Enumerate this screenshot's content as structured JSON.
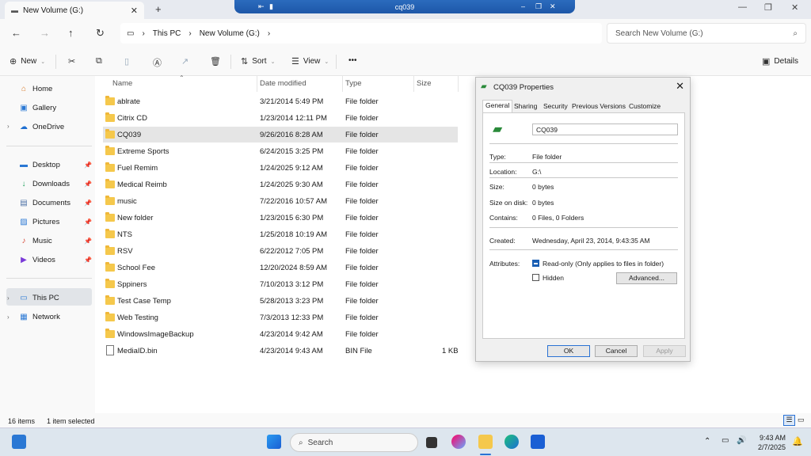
{
  "window": {
    "tab_title": "New Volume (G:)",
    "tab_close": "✕",
    "new_tab": "+",
    "minimize": "—",
    "maximize": "❐",
    "close": "✕"
  },
  "citrix_bar": {
    "title": "cq039"
  },
  "address": {
    "crumbs": [
      "This PC",
      "New Volume (G:)"
    ],
    "search_placeholder": "Search New Volume (G:)"
  },
  "toolbar": {
    "new": "New",
    "sort": "Sort",
    "view": "View",
    "more": "•••",
    "details": "Details"
  },
  "sidebar": {
    "items": [
      {
        "label": "Home",
        "icon": "home-icon"
      },
      {
        "label": "Gallery",
        "icon": "gallery-icon"
      },
      {
        "label": "OneDrive",
        "icon": "cloud-icon"
      },
      {
        "label": "Desktop",
        "icon": "desktop-icon"
      },
      {
        "label": "Downloads",
        "icon": "download-icon"
      },
      {
        "label": "Documents",
        "icon": "documents-icon"
      },
      {
        "label": "Pictures",
        "icon": "pictures-icon"
      },
      {
        "label": "Music",
        "icon": "music-icon"
      },
      {
        "label": "Videos",
        "icon": "videos-icon"
      },
      {
        "label": "This PC",
        "icon": "computer-icon"
      },
      {
        "label": "Network",
        "icon": "network-icon"
      }
    ]
  },
  "columns": {
    "name": "Name",
    "date": "Date modified",
    "type": "Type",
    "size": "Size"
  },
  "files": [
    {
      "name": "ablrate",
      "date": "3/21/2014 5:49 PM",
      "type": "File folder",
      "size": ""
    },
    {
      "name": "Citrix CD",
      "date": "1/23/2014 12:11 PM",
      "type": "File folder",
      "size": ""
    },
    {
      "name": "CQ039",
      "date": "9/26/2016 8:28 AM",
      "type": "File folder",
      "size": ""
    },
    {
      "name": "Extreme Sports",
      "date": "6/24/2015 3:25 PM",
      "type": "File folder",
      "size": ""
    },
    {
      "name": "Fuel Remim",
      "date": "1/24/2025 9:12 AM",
      "type": "File folder",
      "size": ""
    },
    {
      "name": "Medical Reimb",
      "date": "1/24/2025 9:30 AM",
      "type": "File folder",
      "size": ""
    },
    {
      "name": "music",
      "date": "7/22/2016 10:57 AM",
      "type": "File folder",
      "size": ""
    },
    {
      "name": "New folder",
      "date": "1/23/2015 6:30 PM",
      "type": "File folder",
      "size": ""
    },
    {
      "name": "NTS",
      "date": "1/25/2018 10:19 AM",
      "type": "File folder",
      "size": ""
    },
    {
      "name": "RSV",
      "date": "6/22/2012 7:05 PM",
      "type": "File folder",
      "size": ""
    },
    {
      "name": "School Fee",
      "date": "12/20/2024 8:59 AM",
      "type": "File folder",
      "size": ""
    },
    {
      "name": "Sppiners",
      "date": "7/10/2013 3:12 PM",
      "type": "File folder",
      "size": ""
    },
    {
      "name": "Test Case Temp",
      "date": "5/28/2013 3:23 PM",
      "type": "File folder",
      "size": ""
    },
    {
      "name": "Web Testing",
      "date": "7/3/2013 12:33 PM",
      "type": "File folder",
      "size": ""
    },
    {
      "name": "WindowsImageBackup",
      "date": "4/23/2014 9:42 AM",
      "type": "File folder",
      "size": ""
    },
    {
      "name": "MediaID.bin",
      "date": "4/23/2014 9:43 AM",
      "type": "BIN File",
      "size": "1 KB"
    }
  ],
  "dialog": {
    "title": "CQ039 Properties",
    "tabs": [
      "General",
      "Sharing",
      "Security",
      "Previous Versions",
      "Customize"
    ],
    "name": "CQ039",
    "type_label": "Type:",
    "type_value": "File folder",
    "location_label": "Location:",
    "location_value": "G:\\",
    "size_label": "Size:",
    "size_value": "0 bytes",
    "size_disk_label": "Size on disk:",
    "size_disk_value": "0 bytes",
    "contains_label": "Contains:",
    "contains_value": "0 Files, 0 Folders",
    "created_label": "Created:",
    "created_value": "Wednesday, April 23, 2014, 9:43:35 AM",
    "attributes_label": "Attributes:",
    "readonly_label": "Read-only (Only applies to files in folder)",
    "hidden_label": "Hidden",
    "advanced": "Advanced...",
    "ok": "OK",
    "cancel": "Cancel",
    "apply": "Apply"
  },
  "status": {
    "items": "16 items",
    "selected": "1 item selected"
  },
  "taskbar": {
    "search": "Search",
    "time": "9:43 AM",
    "date": "2/7/2025"
  }
}
